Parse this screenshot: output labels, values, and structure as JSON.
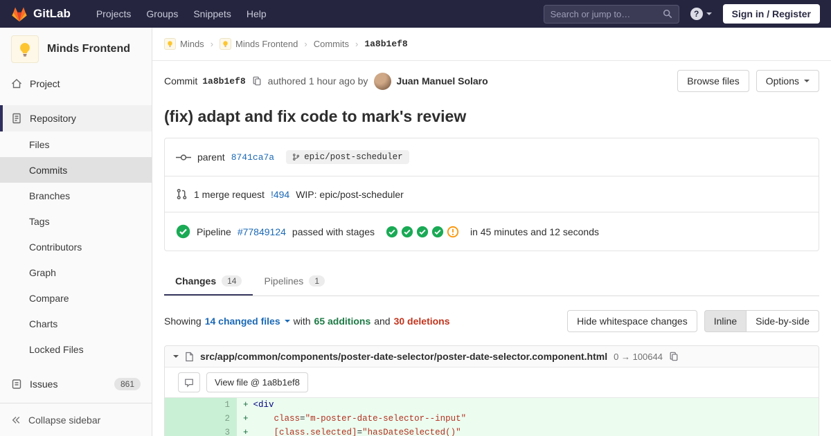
{
  "colors": {
    "brand_orange": "#fc6d26",
    "link_blue": "#1b69b6",
    "success_green": "#1aaa55",
    "danger_red": "#c0341d",
    "warning_orange": "#fc9403"
  },
  "navbar": {
    "brand": "GitLab",
    "menu": [
      "Projects",
      "Groups",
      "Snippets",
      "Help"
    ],
    "search_placeholder": "Search or jump to…",
    "help_glyph": "?",
    "sign_in_label": "Sign in / Register"
  },
  "sidebar": {
    "project_name": "Minds Frontend",
    "project_item": "Project",
    "repository_item": "Repository",
    "repo_children": [
      "Files",
      "Commits",
      "Branches",
      "Tags",
      "Contributors",
      "Graph",
      "Compare",
      "Charts",
      "Locked Files"
    ],
    "issues_item": "Issues",
    "issues_count": "861",
    "collapse_label": "Collapse sidebar"
  },
  "breadcrumb": {
    "group": "Minds",
    "project": "Minds Frontend",
    "section": "Commits",
    "current": "1a8b1ef8"
  },
  "commit": {
    "label": "Commit",
    "sha": "1a8b1ef8",
    "authored": "authored 1 hour ago by",
    "author": "Juan Manuel Solaro",
    "browse_files_label": "Browse files",
    "options_label": "Options",
    "title": "(fix) adapt and fix code to mark's review",
    "parent_label": "parent",
    "parent_sha": "8741ca7a",
    "branch_ref": "epic/post-scheduler",
    "mr_count_text": "1 merge request",
    "mr_id": "!494",
    "mr_title": "WIP: epic/post-scheduler",
    "pipeline_label": "Pipeline",
    "pipeline_id": "#77849124",
    "pipeline_status": "passed with stages",
    "pipeline_duration": "in 45 minutes and 12 seconds"
  },
  "tabs": {
    "changes_label": "Changes",
    "changes_count": "14",
    "pipelines_label": "Pipelines",
    "pipelines_count": "1"
  },
  "summary": {
    "showing": "Showing",
    "changed_files": "14 changed files",
    "with": "with",
    "additions": "65 additions",
    "and": "and",
    "deletions": "30 deletions",
    "hide_whitespace_label": "Hide whitespace changes",
    "inline_label": "Inline",
    "side_by_side_label": "Side-by-side"
  },
  "diff_file": {
    "path": "src/app/common/components/poster-date-selector/poster-date-selector.component.html",
    "mode": "0 → 100644",
    "view_file_label": "View file @ 1a8b1ef8",
    "lines": [
      {
        "old": "",
        "new": "1",
        "sign": "+",
        "indent": "",
        "tag": "<div",
        "attr": "",
        "eq": "",
        "str": ""
      },
      {
        "old": "",
        "new": "2",
        "sign": "+",
        "indent": "    ",
        "tag": "",
        "attr": "class",
        "eq": "=",
        "str": "\"m-poster-date-selector--input\""
      },
      {
        "old": "",
        "new": "3",
        "sign": "+",
        "indent": "    ",
        "tag": "",
        "attr": "[class.selected]",
        "eq": "=",
        "str": "\"hasDateSelected()\""
      }
    ]
  }
}
